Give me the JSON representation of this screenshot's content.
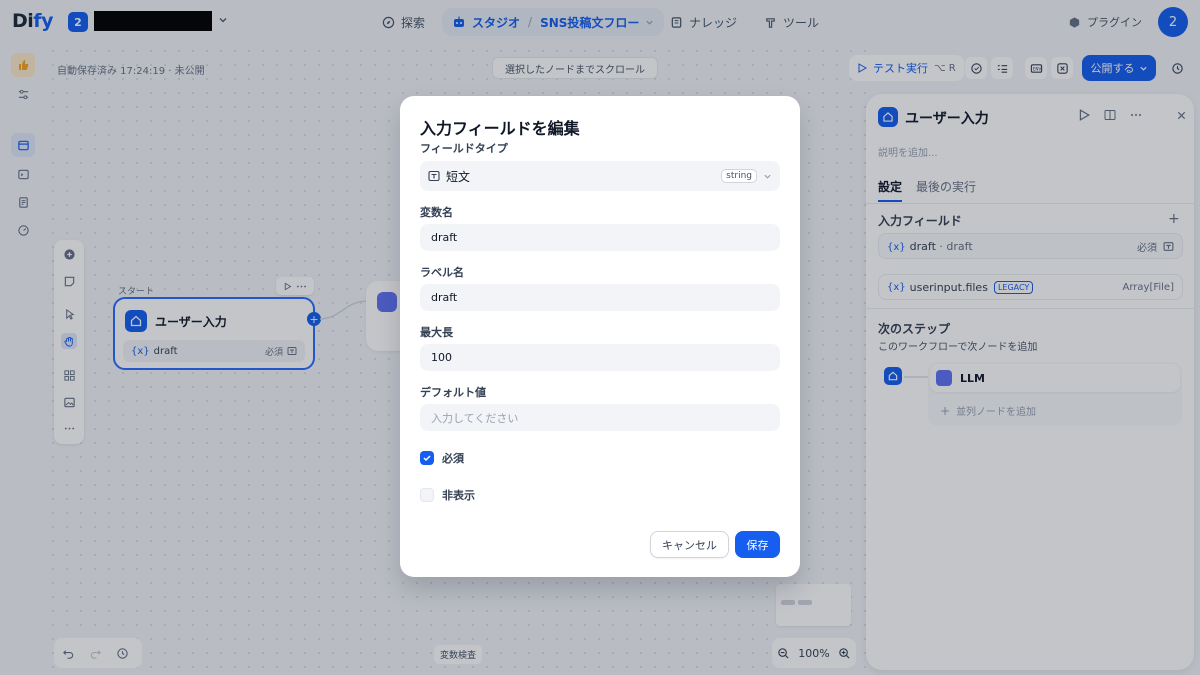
{
  "app": {
    "logo_main": "Di",
    "logo_accent": "fy",
    "workspace_badge": "2"
  },
  "nav": {
    "explore": "探索",
    "studio": "スタジオ",
    "app_name": "SNS投稿文フロー",
    "knowledge": "ナレッジ",
    "tools": "ツール",
    "plugin": "プラグイン",
    "avatar": "2"
  },
  "canvas": {
    "autosave": "自動保存済み 17:24:19 · 未公開",
    "scroll_button": "選択したノードまでスクロール",
    "start_label": "スタート",
    "start_node_title": "ユーザー入力",
    "start_node_var": "draft",
    "start_node_required": "必須",
    "variable_inspect": "変数検査",
    "zoom": "100%"
  },
  "header_actions": {
    "test_run": "テスト実行",
    "test_run_shortcut": "⌥ R",
    "publish": "公開する"
  },
  "panel": {
    "title": "ユーザー入力",
    "description_placeholder": "説明を追加...",
    "tabs": [
      {
        "label": "設定",
        "active": true
      },
      {
        "label": "最後の実行",
        "active": false
      }
    ],
    "input_fields_label": "入力フィールド",
    "fields": [
      {
        "name": "draft",
        "label": "draft",
        "tag": "必須"
      },
      {
        "name": "userinput.files",
        "badge": "LEGACY",
        "type": "Array[File]"
      }
    ],
    "next_step_label": "次のステップ",
    "next_step_desc": "このワークフローで次ノードを追加",
    "next_node": "LLM",
    "add_parallel": "並列ノードを追加"
  },
  "modal": {
    "title": "入力フィールドを編集",
    "field_type_label": "フィールドタイプ",
    "field_type_value": "短文",
    "field_type_badge": "string",
    "var_name_label": "変数名",
    "var_name_value": "draft",
    "label_name_label": "ラベル名",
    "label_name_value": "draft",
    "max_length_label": "最大長",
    "max_length_value": "100",
    "default_label": "デフォルト値",
    "default_placeholder": "入力してください",
    "required_label": "必須",
    "required_checked": true,
    "hidden_label": "非表示",
    "hidden_checked": false,
    "cancel": "キャンセル",
    "save": "保存"
  }
}
